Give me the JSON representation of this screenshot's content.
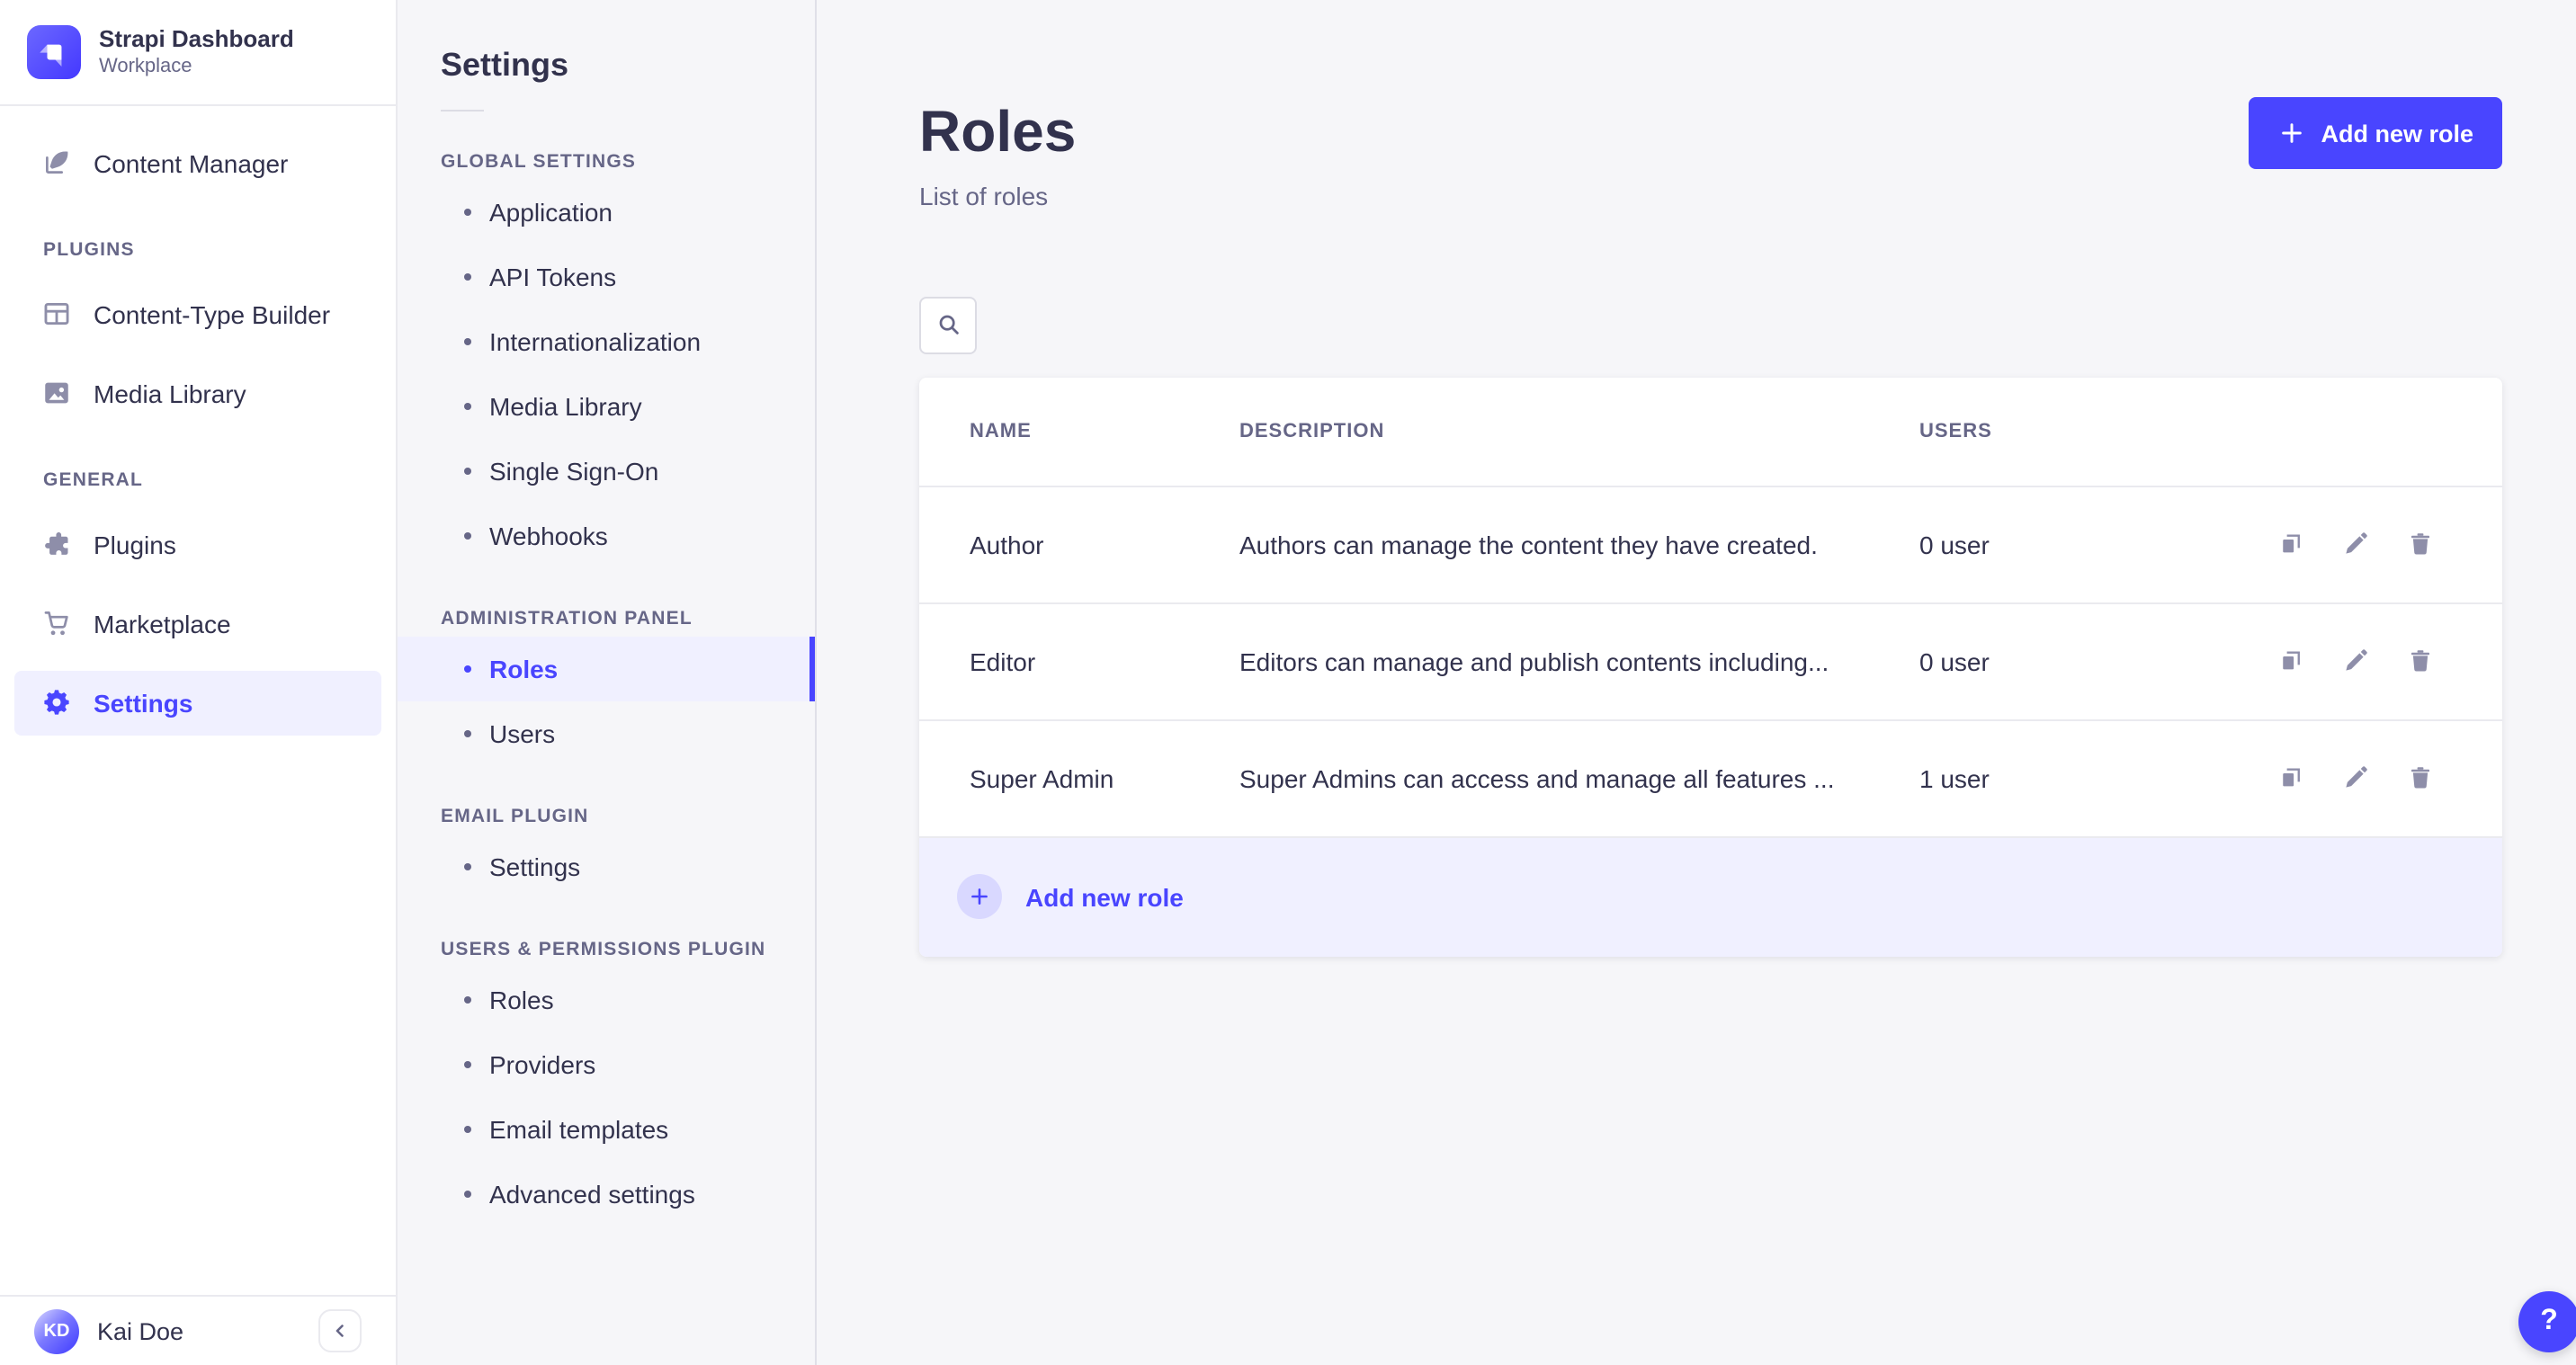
{
  "colors": {
    "primary": "#4945ff",
    "primary_light": "#f0f0ff",
    "primary_lighter": "#d9d8ff",
    "text_dark": "#32324d",
    "text_muted": "#666687",
    "icon_muted": "#8e8ea9",
    "border": "#eaeaef",
    "page_bg": "#f6f6f9",
    "surface": "#ffffff"
  },
  "nav": {
    "brand": {
      "title": "Strapi Dashboard",
      "subtitle": "Workplace"
    },
    "content_manager": {
      "label": "Content Manager"
    },
    "sections": [
      {
        "title": "PLUGINS",
        "items": [
          {
            "label": "Content-Type Builder"
          },
          {
            "label": "Media Library"
          }
        ]
      },
      {
        "title": "GENERAL",
        "items": [
          {
            "label": "Plugins"
          },
          {
            "label": "Marketplace"
          },
          {
            "label": "Settings"
          }
        ]
      }
    ],
    "footer": {
      "initials": "KD",
      "name": "Kai Doe"
    }
  },
  "subnav": {
    "title": "Settings",
    "sections": [
      {
        "title": "GLOBAL SETTINGS",
        "items": [
          {
            "label": "Application"
          },
          {
            "label": "API Tokens"
          },
          {
            "label": "Internationalization"
          },
          {
            "label": "Media Library"
          },
          {
            "label": "Single Sign-On"
          },
          {
            "label": "Webhooks"
          }
        ]
      },
      {
        "title": "ADMINISTRATION PANEL",
        "items": [
          {
            "label": "Roles"
          },
          {
            "label": "Users"
          }
        ]
      },
      {
        "title": "EMAIL PLUGIN",
        "items": [
          {
            "label": "Settings"
          }
        ]
      },
      {
        "title": "USERS & PERMISSIONS PLUGIN",
        "items": [
          {
            "label": "Roles"
          },
          {
            "label": "Providers"
          },
          {
            "label": "Email templates"
          },
          {
            "label": "Advanced settings"
          }
        ]
      }
    ]
  },
  "main": {
    "title": "Roles",
    "subtitle": "List of roles",
    "add_new_role_button": "Add new role",
    "table": {
      "columns": [
        "NAME",
        "DESCRIPTION",
        "USERS"
      ],
      "rows": [
        {
          "name": "Author",
          "description": "Authors can manage the content they have created.",
          "users": "0 user"
        },
        {
          "name": "Editor",
          "description": "Editors can manage and publish contents including...",
          "users": "0 user"
        },
        {
          "name": "Super Admin",
          "description": "Super Admins can access and manage all features ...",
          "users": "1 user"
        }
      ],
      "footer_add_label": "Add new role"
    },
    "help_button": "?"
  }
}
